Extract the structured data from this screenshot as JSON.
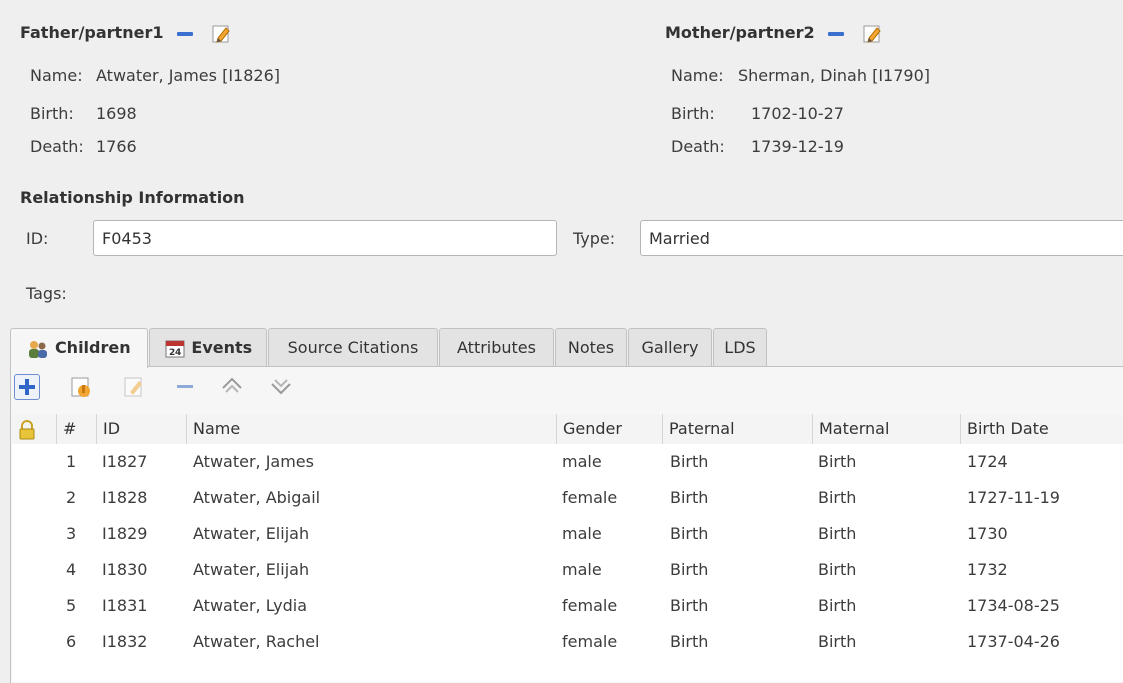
{
  "father": {
    "header": "Father/partner1",
    "name_label": "Name:",
    "name": "Atwater, James [I1826]",
    "birth_label": "Birth:",
    "birth": "1698",
    "death_label": "Death:",
    "death": "1766"
  },
  "mother": {
    "header": "Mother/partner2",
    "name_label": "Name:",
    "name": "Sherman, Dinah [I1790]",
    "birth_label": "Birth:",
    "birth": "1702-10-27",
    "death_label": "Death:",
    "death": "1739-12-19"
  },
  "relationship": {
    "header": "Relationship Information",
    "id_label": "ID:",
    "id_value": "F0453",
    "type_label": "Type:",
    "type_value": "Married",
    "tags_label": "Tags:"
  },
  "tabs": [
    {
      "label": "Children",
      "icon": "children-icon"
    },
    {
      "label": "Events",
      "icon": "events-icon"
    },
    {
      "label": "Source Citations"
    },
    {
      "label": "Attributes"
    },
    {
      "label": "Notes"
    },
    {
      "label": "Gallery"
    },
    {
      "label": "LDS"
    }
  ],
  "toolbar": [
    "add-icon",
    "share-existing-icon",
    "edit-icon",
    "remove-icon",
    "move-up-icon",
    "move-down-icon"
  ],
  "table": {
    "columns": [
      "#",
      "ID",
      "Name",
      "Gender",
      "Paternal",
      "Maternal",
      "Birth Date"
    ],
    "rows": [
      {
        "num": "1",
        "id": "I1827",
        "name": "Atwater, James",
        "gender": "male",
        "paternal": "Birth",
        "maternal": "Birth",
        "birth": "1724"
      },
      {
        "num": "2",
        "id": "I1828",
        "name": "Atwater, Abigail",
        "gender": "female",
        "paternal": "Birth",
        "maternal": "Birth",
        "birth": "1727-11-19"
      },
      {
        "num": "3",
        "id": "I1829",
        "name": "Atwater, Elijah",
        "gender": "male",
        "paternal": "Birth",
        "maternal": "Birth",
        "birth": "1730"
      },
      {
        "num": "4",
        "id": "I1830",
        "name": "Atwater, Elijah",
        "gender": "male",
        "paternal": "Birth",
        "maternal": "Birth",
        "birth": "1732"
      },
      {
        "num": "5",
        "id": "I1831",
        "name": "Atwater, Lydia",
        "gender": "female",
        "paternal": "Birth",
        "maternal": "Birth",
        "birth": "1734-08-25"
      },
      {
        "num": "6",
        "id": "I1832",
        "name": "Atwater, Rachel",
        "gender": "female",
        "paternal": "Birth",
        "maternal": "Birth",
        "birth": "1737-04-26"
      }
    ]
  },
  "colors": {
    "accent": "#3b6fd0",
    "window_bg": "#efefef"
  }
}
